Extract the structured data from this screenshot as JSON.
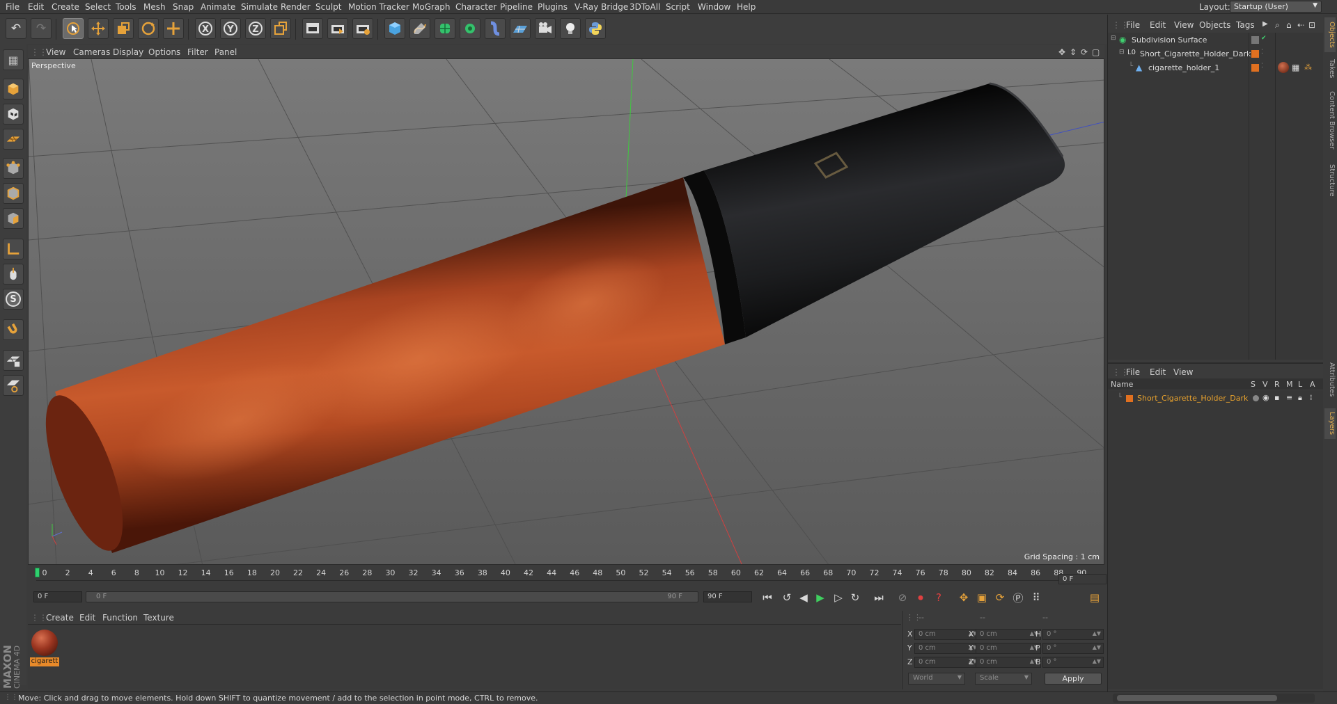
{
  "menubar": {
    "items": [
      "File",
      "Edit",
      "Create",
      "Select",
      "Tools",
      "Mesh",
      "Snap",
      "Animate",
      "Simulate",
      "Render",
      "Sculpt",
      "Motion Tracker",
      "MoGraph",
      "Character",
      "Pipeline",
      "Plugins",
      "V-Ray Bridge",
      "3DToAll",
      "Script",
      "Window",
      "Help"
    ],
    "layout_label": "Layout:",
    "layout_value": "Startup (User)"
  },
  "toolbar": {
    "icons": [
      "undo-icon",
      "redo-icon",
      "live-selection-icon",
      "move-icon",
      "scale-icon",
      "rotate-icon",
      "last-tool-icon",
      "x-axis-icon",
      "y-axis-icon",
      "z-axis-icon",
      "coordinate-system-icon",
      "render-view-icon",
      "render-picture-viewer-icon",
      "edit-render-settings-icon",
      "cube-icon",
      "pen-spline-icon",
      "subdivision-icon",
      "cloner-icon",
      "deformer-icon",
      "floor-icon",
      "camera-icon",
      "light-icon",
      "python-icon"
    ],
    "axis_labels": [
      "X",
      "Y",
      "Z"
    ]
  },
  "lefttools": {
    "icons": [
      "make-editable-icon",
      "model-mode-icon",
      "texture-mode-icon",
      "workplane-icon",
      "points-mode-icon",
      "edges-mode-icon",
      "polygons-mode-icon",
      "axis-mode-icon",
      "tweak-mode-icon",
      "solo-icon",
      "snap-icon",
      "workplane-lock-icon",
      "locked-workplane-icon"
    ],
    "solo_letter": "S"
  },
  "viewport": {
    "menu": [
      "View",
      "Cameras",
      "Display",
      "Options",
      "Filter",
      "Panel"
    ],
    "camera_label": "Perspective",
    "grid_spacing": "Grid Spacing : 1 cm",
    "nav_icons": [
      "move-view-icon",
      "zoom-view-icon",
      "rotate-view-icon",
      "maximize-view-icon"
    ]
  },
  "timeline": {
    "ticks": [
      "0",
      "2",
      "4",
      "6",
      "8",
      "10",
      "12",
      "14",
      "16",
      "18",
      "20",
      "22",
      "24",
      "26",
      "28",
      "30",
      "32",
      "34",
      "36",
      "38",
      "40",
      "42",
      "44",
      "46",
      "48",
      "50",
      "52",
      "54",
      "56",
      "58",
      "60",
      "62",
      "64",
      "66",
      "68",
      "70",
      "72",
      "74",
      "76",
      "78",
      "80",
      "82",
      "84",
      "86",
      "88",
      "90"
    ],
    "current_frame_field": "0 F"
  },
  "transport": {
    "start_field": "0 F",
    "slider_left": "0 F",
    "slider_right": "90 F",
    "end_field": "90 F",
    "buttons": [
      "go-to-start-icon",
      "prev-key-icon",
      "prev-frame-icon",
      "play-icon",
      "next-frame-icon",
      "next-key-icon",
      "go-to-end-icon",
      "record-icon",
      "autokey-icon",
      "keyframe-selection-icon",
      "move-key-icon",
      "scale-key-icon",
      "rotate-key-icon",
      "param-key-icon",
      "pla-key-icon",
      "timeline-icon"
    ]
  },
  "materials": {
    "menu": [
      "Create",
      "Edit",
      "Function",
      "Texture"
    ],
    "items": [
      {
        "name": "cigarett"
      }
    ]
  },
  "coordinates": {
    "headers": [
      "--",
      "--",
      "--"
    ],
    "rows": [
      {
        "axis": "X",
        "pos": "0 cm",
        "size_axis": "X",
        "size": "0 cm",
        "rot_axis": "H",
        "rot": "0 °"
      },
      {
        "axis": "Y",
        "pos": "0 cm",
        "size_axis": "Y",
        "size": "0 cm",
        "rot_axis": "P",
        "rot": "0 °"
      },
      {
        "axis": "Z",
        "pos": "0 cm",
        "size_axis": "Z",
        "size": "0 cm",
        "rot_axis": "B",
        "rot": "0 °"
      }
    ],
    "mode_dropdown": "World",
    "size_dropdown": "Scale",
    "apply_label": "Apply"
  },
  "object_manager": {
    "menu": [
      "File",
      "Edit",
      "View",
      "Objects",
      "Tags"
    ],
    "objects": [
      {
        "name": "Subdivision Surface",
        "icon": "subdivision-surface-icon"
      },
      {
        "name": "Short_Cigarette_Holder_Dark",
        "icon": "null-object-icon"
      },
      {
        "name": "cigarette_holder_1",
        "icon": "polygon-object-icon"
      }
    ]
  },
  "layer_manager": {
    "menu": [
      "File",
      "Edit",
      "View"
    ],
    "columns": [
      "Name",
      "S",
      "V",
      "R",
      "M",
      "L",
      "A"
    ],
    "layers": [
      {
        "name": "Short_Cigarette_Holder_Dark",
        "color": "#e07020"
      }
    ]
  },
  "sidetabs": [
    "Objects",
    "Takes",
    "Content Browser",
    "Structure",
    "Attributes",
    "Layers"
  ],
  "status": {
    "text": "Move: Click and drag to move elements. Hold down SHIFT to quantize movement / add to the selection in point mode, CTRL to remove."
  },
  "branding": {
    "logo_line1": "MAXON",
    "logo_line2": "CINEMA 4D"
  },
  "colors": {
    "accent": "#e8a22d",
    "viewport_bg": "#606060",
    "wood": "#b5461f",
    "mouthpiece": "#1d1e20",
    "active_frame": "#2fd26f"
  }
}
